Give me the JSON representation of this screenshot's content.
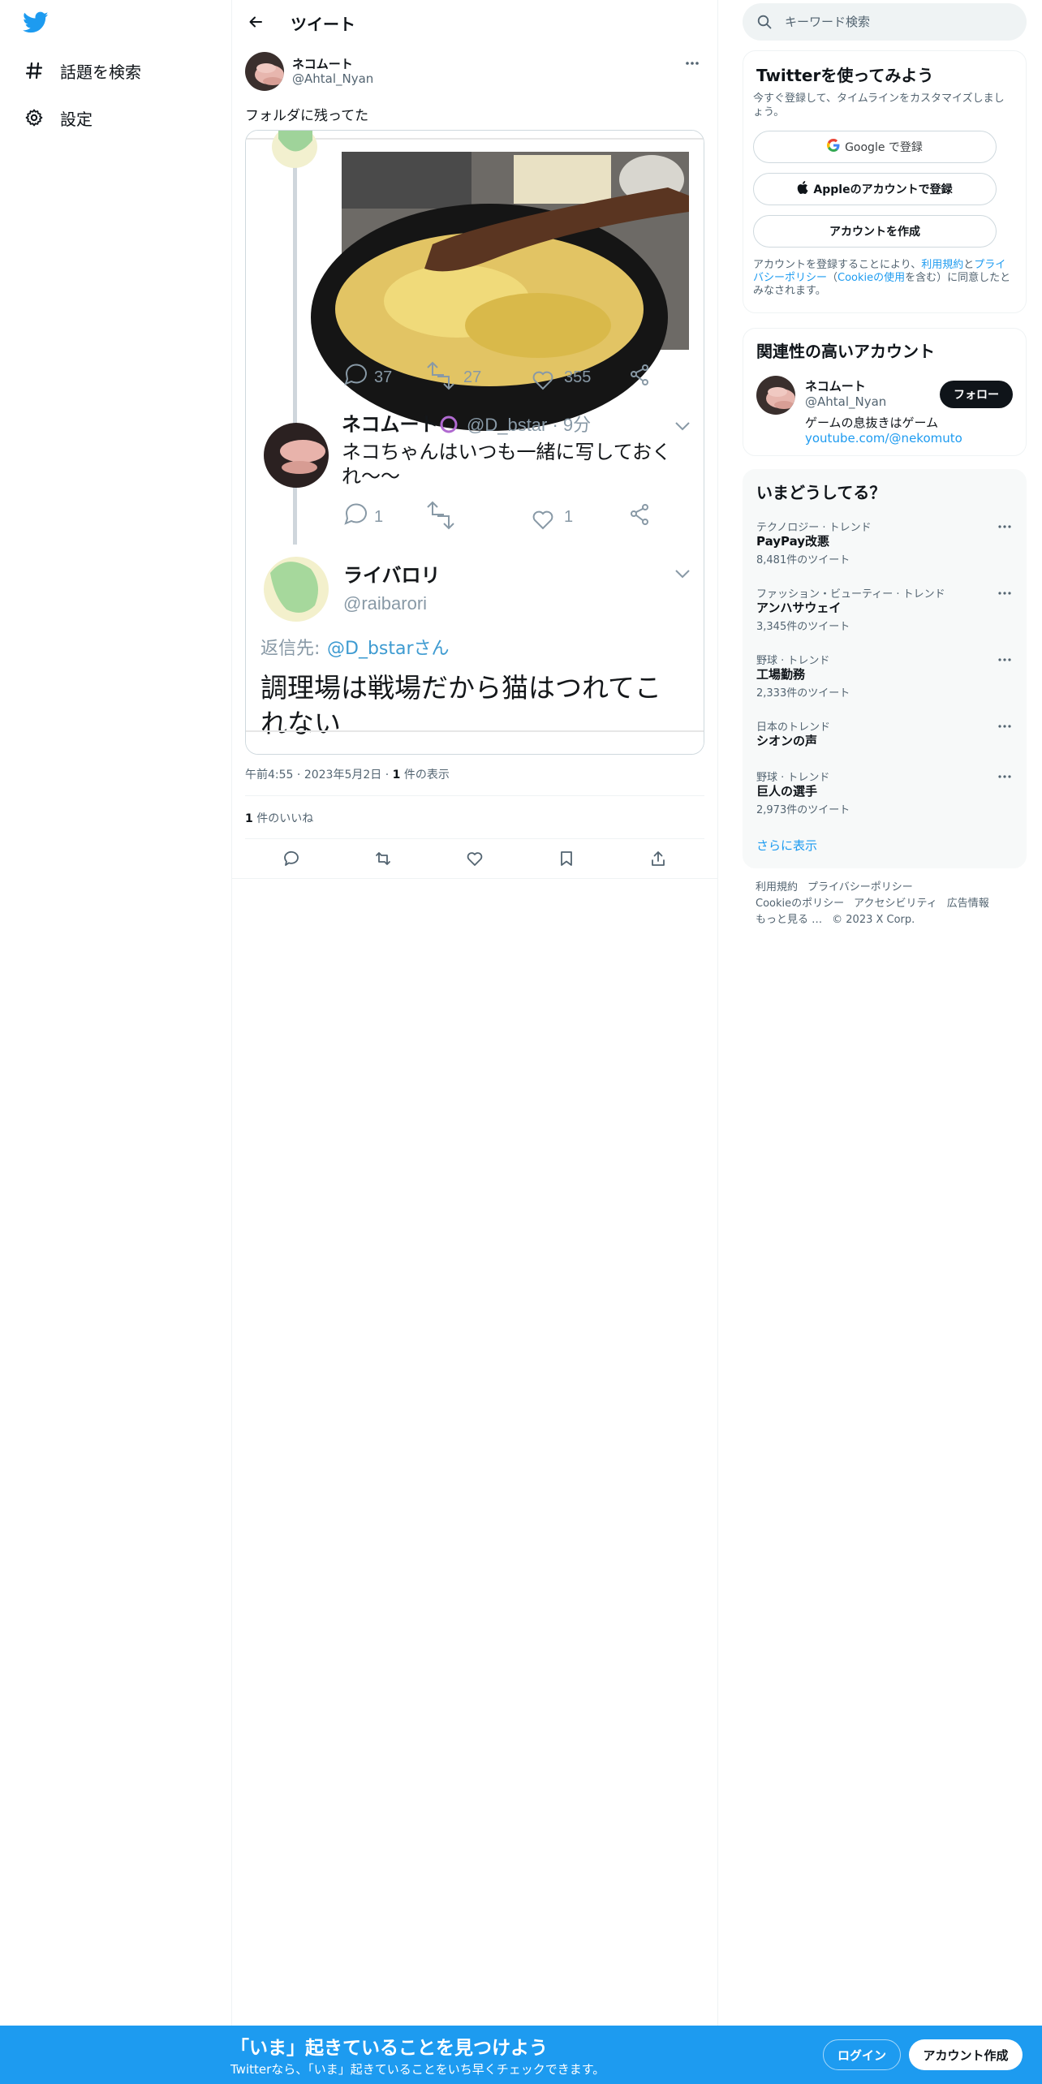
{
  "nav": {
    "items": [
      {
        "label": "話題を検索",
        "icon": "hashtag-icon"
      },
      {
        "label": "設定",
        "icon": "gear-icon"
      }
    ]
  },
  "header": {
    "title": "ツイート"
  },
  "tweet": {
    "author_name": "ネコムート",
    "author_handle": "@Ahtal_Nyan",
    "text": "フォルダに残ってた",
    "time": "午前4:55",
    "date": "2023年5月2日",
    "views_count": "1",
    "views_label": " 件の表示",
    "likes_count": "1",
    "likes_label": " 件のいいね"
  },
  "screenshot": {
    "post1": {
      "replies": "37",
      "retweets": "27",
      "likes": "355"
    },
    "post2": {
      "name": "ネコムート",
      "handle_time": "@D_bstar · 9分",
      "text_line1": "ネコちゃんはいつも一緒に写しておく",
      "text_line2": "れ〜〜",
      "replies": "1",
      "likes": "1"
    },
    "post3": {
      "name": "ライバロリ",
      "handle": "@raibarori",
      "reply_prefix": "返信先: ",
      "reply_to": "@D_bstarさん",
      "text_line1": "調理場は戦場だから猫はつれてこ",
      "text_line2": "れない"
    }
  },
  "search": {
    "placeholder": "キーワード検索"
  },
  "signup": {
    "title": "Twitterを使ってみよう",
    "subtitle": "今すぐ登録して、タイムラインをカスタマイズしましょう。",
    "google_label": "Google で登録",
    "apple_label": "Appleのアカウントで登録",
    "create_label": "アカウントを作成",
    "legal_prefix": "アカウントを登録することにより、",
    "legal_terms": "利用規約",
    "legal_and": "と",
    "legal_privacy": "プライバシーポリシー",
    "legal_paren_open": "（",
    "legal_cookie": "Cookieの使用",
    "legal_suffix": "を含む）に同意したとみなされます。"
  },
  "related": {
    "title": "関連性の高いアカウント",
    "name": "ネコムート",
    "handle": "@Ahtal_Nyan",
    "bio": "ゲームの息抜きはゲーム",
    "link": "youtube.com/@nekomuto",
    "follow_label": "フォロー"
  },
  "trends": {
    "title": "いまどうしてる？",
    "items": [
      {
        "category": "テクノロジー · トレンド",
        "name": "PayPay改悪",
        "count": "8,481件のツイート"
      },
      {
        "category": "ファッション・ビューティー · トレンド",
        "name": "アンハサウェイ",
        "count": "3,345件のツイート"
      },
      {
        "category": "野球 · トレンド",
        "name": "工場勤務",
        "count": "2,333件のツイート"
      },
      {
        "category": "日本のトレンド",
        "name": "シオンの声",
        "count": ""
      },
      {
        "category": "野球 · トレンド",
        "name": "巨人の選手",
        "count": "2,973件のツイート"
      }
    ],
    "show_more": "さらに表示"
  },
  "footer": {
    "links": [
      "利用規約",
      "プライバシーポリシー",
      "Cookieのポリシー",
      "アクセシビリティ",
      "広告情報",
      "もっと見る …",
      "© 2023 X Corp."
    ]
  },
  "bottom": {
    "title": "「いま」起きていることを見つけよう",
    "subtitle": "Twitterなら、「いま」起きていることをいち早くチェックできます。",
    "login_label": "ログイン",
    "signup_label": "アカウント作成"
  },
  "colors": {
    "accent": "#1d9bf0",
    "text": "#0f1419",
    "secondary": "#536471"
  }
}
